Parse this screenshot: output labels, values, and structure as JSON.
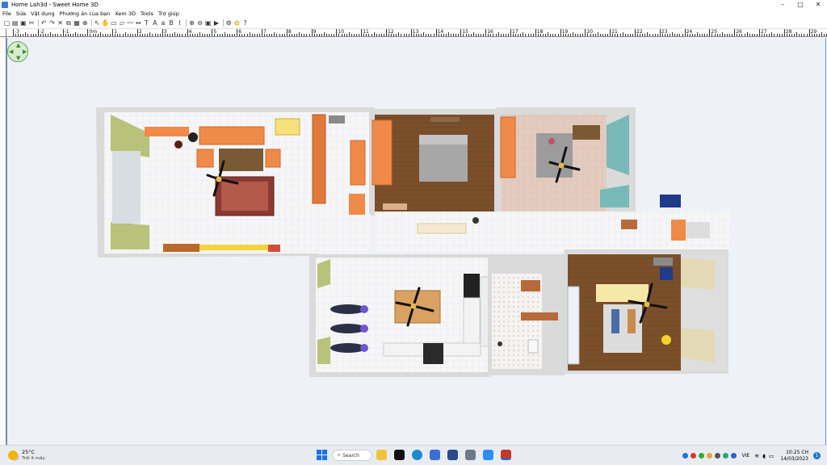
{
  "window": {
    "title": "Home Lah3d - Sweet Home 3D",
    "minimize": "–",
    "maximize": "□",
    "close": "✕"
  },
  "menu": [
    "File",
    "Sửa",
    "Vật dụng",
    "Phương án của bạn",
    "Xem 3D",
    "Tools",
    "Trợ giúp"
  ],
  "toolbar_icons": [
    "new-home-icon",
    "open-icon",
    "save-icon",
    "cut-tool-icon",
    "undo-icon",
    "redo-icon",
    "delete-icon",
    "copy-icon",
    "paste-icon",
    "add-furniture-icon",
    "select-icon",
    "pan-icon",
    "create-walls-icon",
    "create-rooms-icon",
    "create-polylines-icon",
    "create-dimensions-icon",
    "create-labels-icon",
    "increase-text-icon",
    "decrease-text-icon",
    "bold-text-icon",
    "italic-text-icon",
    "zoom-in-icon",
    "zoom-out-icon",
    "create-photo-icon",
    "create-video-icon",
    "preferences-icon",
    "plugin-icon",
    "help-icon"
  ],
  "ruler": {
    "labels": [
      "-3",
      "-2",
      "-1",
      "0m",
      "1",
      "2",
      "3",
      "4",
      "5",
      "6",
      "7",
      "8",
      "9",
      "10",
      "11",
      "12",
      "13",
      "14",
      "15",
      "16",
      "17",
      "18",
      "19",
      "20",
      "21",
      "22",
      "23",
      "24",
      "25",
      "26",
      "27",
      "28",
      "29"
    ]
  },
  "taskbar": {
    "temperature": "25°C",
    "weather": "Trời ít mây",
    "search": "Search",
    "language": "VIE",
    "time": "10:25 CH",
    "date": "14/03/2023",
    "notifications": "1"
  },
  "colors": {
    "accent": "#1a73e8",
    "wall": "#e9e9e9",
    "floor_tile": "#f4f4f4",
    "wood_floor": "#7a5230",
    "orange_furniture": "#f08a48"
  }
}
